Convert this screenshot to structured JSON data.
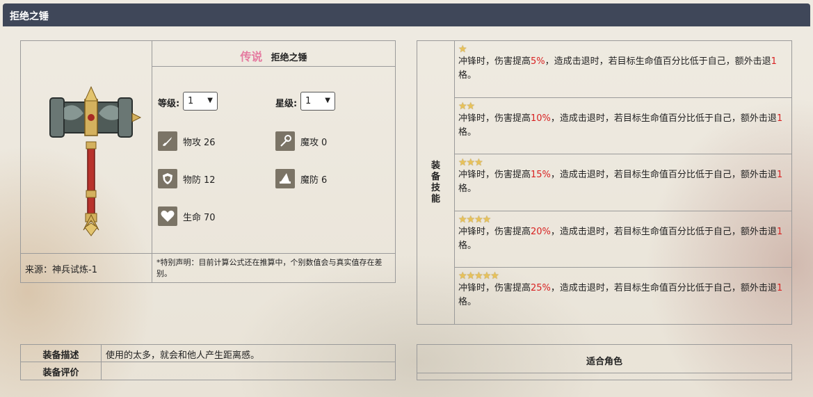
{
  "window": {
    "title": "拒绝之锤"
  },
  "item": {
    "rarity": "传说",
    "name": "拒绝之锤",
    "source": "来源：神兵试炼-1",
    "note": "*特别声明：目前计算公式还在推算中，个别数值会与真实值存在差别。"
  },
  "selectors": {
    "level_label": "等级:",
    "level_value": "1",
    "star_label": "星级:",
    "star_value": "1"
  },
  "stats": [
    {
      "label": "物攻",
      "value": "26",
      "icon": "sword-icon"
    },
    {
      "label": "魔攻",
      "value": "0",
      "icon": "staff-icon"
    },
    {
      "label": "物防",
      "value": "12",
      "icon": "shield-icon"
    },
    {
      "label": "魔防",
      "value": "6",
      "icon": "wizard-hat-icon"
    },
    {
      "label": "生命",
      "value": "70",
      "icon": "heart-icon"
    }
  ],
  "skills": {
    "label": "装备技能",
    "rows": [
      {
        "stars": "★",
        "text_before": "冲锋时，伤害提高",
        "pct": "5%",
        "text_mid": "，造成击退时，若目标生命值百分比低于自己，额外击退",
        "num": "1",
        "text_after": "格。"
      },
      {
        "stars": "★★",
        "text_before": "冲锋时，伤害提高",
        "pct": "10%",
        "text_mid": "，造成击退时，若目标生命值百分比低于自己，额外击退",
        "num": "1",
        "text_after": "格。"
      },
      {
        "stars": "★★★",
        "text_before": "冲锋时，伤害提高",
        "pct": "15%",
        "text_mid": "，造成击退时，若目标生命值百分比低于自己，额外击退",
        "num": "1",
        "text_after": "格。"
      },
      {
        "stars": "★★★★",
        "text_before": "冲锋时，伤害提高",
        "pct": "20%",
        "text_mid": "，造成击退时，若目标生命值百分比低于自己，额外击退",
        "num": "1",
        "text_after": "格。"
      },
      {
        "stars": "★★★★★",
        "text_before": "冲锋时，伤害提高",
        "pct": "25%",
        "text_mid": "，造成击退时，若目标生命值百分比低于自己，额外击退",
        "num": "1",
        "text_after": "格。"
      }
    ]
  },
  "description": {
    "desc_label": "装备描述",
    "desc_value": "使用的太多，就会和他人产生距离感。",
    "rating_label": "装备评价",
    "rating_value": ""
  },
  "roles": {
    "label": "适合角色"
  },
  "colors": {
    "title_bar": "#3f4759",
    "highlight": "#d82222",
    "rarity": "#e57aa0",
    "star": "#e8c25a"
  }
}
